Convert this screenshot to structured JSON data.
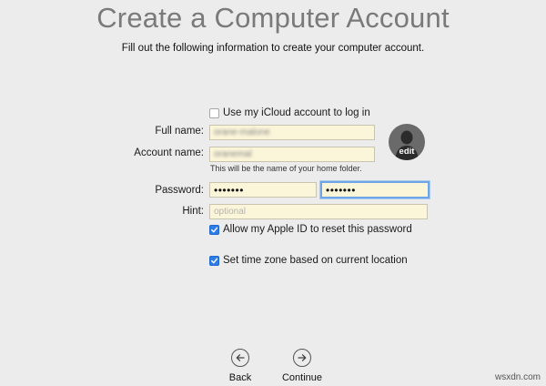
{
  "page": {
    "title": "Create a Computer Account",
    "subtitle": "Fill out the following information to create your computer account."
  },
  "form": {
    "icloud_checkbox": {
      "label": "Use my iCloud account to log in",
      "checked": false
    },
    "full_name": {
      "label": "Full name:",
      "value": "orane-malone"
    },
    "account_name": {
      "label": "Account name:",
      "value": "oranemal",
      "note": "This will be the name of your home folder."
    },
    "password": {
      "label": "Password:",
      "value": "•••••••",
      "verify_value": "•••••••"
    },
    "hint": {
      "label": "Hint:",
      "placeholder": "optional"
    },
    "apple_id_checkbox": {
      "label": "Allow my Apple ID to reset this password",
      "checked": true
    },
    "timezone_checkbox": {
      "label": "Set time zone based on current location",
      "checked": true
    }
  },
  "avatar": {
    "edit_label": "edit"
  },
  "navigation": {
    "back_label": "Back",
    "continue_label": "Continue"
  },
  "watermark": "wsxdn.com",
  "colors": {
    "background": "#ececec",
    "field_fill": "#fbf5d9",
    "checkbox_accent": "#2e7ce6",
    "focus_ring": "#6fa6e8"
  }
}
